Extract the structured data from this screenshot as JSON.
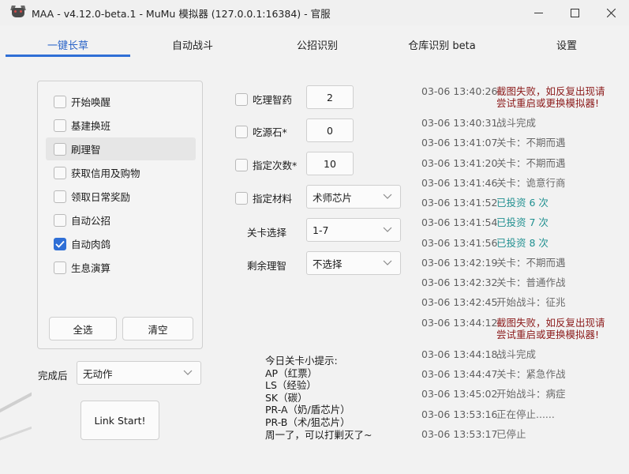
{
  "window": {
    "title": "MAA - v4.12.0-beta.1 - MuMu 模拟器 (127.0.0.1:16384) - 官服"
  },
  "tabs": [
    {
      "label": "一键长草",
      "active": true
    },
    {
      "label": "自动战斗",
      "active": false
    },
    {
      "label": "公招识别",
      "active": false
    },
    {
      "label": "仓库识别 beta",
      "active": false
    },
    {
      "label": "设置",
      "active": false
    }
  ],
  "tasks": [
    {
      "label": "开始唤醒",
      "checked": false
    },
    {
      "label": "基建换班",
      "checked": false
    },
    {
      "label": "刷理智",
      "checked": false
    },
    {
      "label": "获取信用及购物",
      "checked": false
    },
    {
      "label": "领取日常奖励",
      "checked": false
    },
    {
      "label": "自动公招",
      "checked": false
    },
    {
      "label": "自动肉鸽",
      "checked": true
    },
    {
      "label": "生息演算",
      "checked": false
    }
  ],
  "task_buttons": {
    "select_all": "全选",
    "clear": "清空"
  },
  "after_complete": {
    "label": "完成后",
    "value": "无动作"
  },
  "start_button": "Link Start!",
  "form": {
    "medicine": {
      "label": "吃理智药",
      "value": "2",
      "checked": false
    },
    "stone": {
      "label": "吃源石*",
      "value": "0",
      "checked": false
    },
    "times": {
      "label": "指定次数*",
      "value": "10",
      "checked": false
    },
    "material": {
      "label": "指定材料",
      "value": "术师芯片",
      "checked": false
    },
    "stage": {
      "label": "关卡选择",
      "value": "1-7"
    },
    "remaining": {
      "label": "剩余理智",
      "value": "不选择"
    }
  },
  "tips": [
    "今日关卡小提示:",
    "AP（红票）",
    "LS（经验）",
    "SK（碳）",
    "PR-A（奶/盾芯片）",
    "PR-B（术/狙芯片）",
    "周一了，可以打剿灭了~"
  ],
  "log": [
    {
      "time": "03-06  13:40:26",
      "msg": "截图失败，如反复出现请尝试重启或更换模拟器!",
      "color": "#8b1a1a"
    },
    {
      "time": "03-06  13:40:31",
      "msg": "战斗完成",
      "color": "#6a6a6a"
    },
    {
      "time": "03-06  13:41:07",
      "msg": "关卡：不期而遇",
      "color": "#6a6a6a"
    },
    {
      "time": "03-06  13:41:20",
      "msg": "关卡：不期而遇",
      "color": "#6a6a6a"
    },
    {
      "time": "03-06  13:41:46",
      "msg": "关卡：诡意行商",
      "color": "#6a6a6a"
    },
    {
      "time": "03-06  13:41:52",
      "msg": "已投资 6 次",
      "color": "#1f8f8f"
    },
    {
      "time": "03-06  13:41:54",
      "msg": "已投资 7 次",
      "color": "#1f8f8f"
    },
    {
      "time": "03-06  13:41:56",
      "msg": "已投资 8 次",
      "color": "#1f8f8f"
    },
    {
      "time": "03-06  13:42:19",
      "msg": "关卡：不期而遇",
      "color": "#6a6a6a"
    },
    {
      "time": "03-06  13:42:32",
      "msg": "关卡：普通作战",
      "color": "#6a6a6a"
    },
    {
      "time": "03-06  13:42:45",
      "msg": "开始战斗：征兆",
      "color": "#6a6a6a"
    },
    {
      "time": "03-06  13:44:12",
      "msg": "截图失败，如反复出现请尝试重启或更换模拟器!",
      "color": "#8b1a1a"
    },
    {
      "time": "03-06  13:44:18",
      "msg": "战斗完成",
      "color": "#6a6a6a"
    },
    {
      "time": "03-06  13:44:47",
      "msg": "关卡：紧急作战",
      "color": "#6a6a6a"
    },
    {
      "time": "03-06  13:45:02",
      "msg": "开始战斗：病症",
      "color": "#6a6a6a"
    },
    {
      "time": "03-06  13:53:16",
      "msg": "正在停止......",
      "color": "#6a6a6a"
    },
    {
      "time": "03-06  13:53:17",
      "msg": "已停止",
      "color": "#6a6a6a"
    }
  ],
  "colors": {
    "accent": "#2f6fd6",
    "error": "#8b1a1a",
    "info": "#1f8f8f"
  },
  "icons": [
    "app-icon",
    "minimize-icon",
    "maximize-icon",
    "close-icon",
    "check-icon",
    "chevron-down-icon"
  ]
}
